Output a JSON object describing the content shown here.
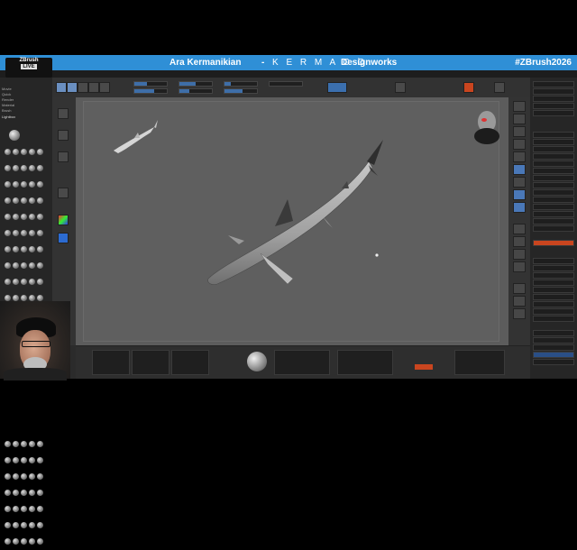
{
  "banner": {
    "host": "Ara Kermanikian",
    "separator": "-",
    "brand": "K E R M A C O",
    "brand_suffix": "Designworks",
    "hashtag": "#ZBrush2026",
    "logo_top": "ZBrush",
    "logo_live": "LIVE",
    "color": "#2f8fd6"
  },
  "left_panel": {
    "menu_items": [
      "Movie",
      "Quick",
      "Render",
      "Material",
      "Brush"
    ],
    "lightbox": "Lightbox"
  },
  "colors": {
    "accent": "#2f8fd6",
    "ui_dark": "#2b2b2b",
    "canvas": "#5f5f5f",
    "active_blue": "#3e6ea8",
    "alert_orange": "#c9451f"
  }
}
